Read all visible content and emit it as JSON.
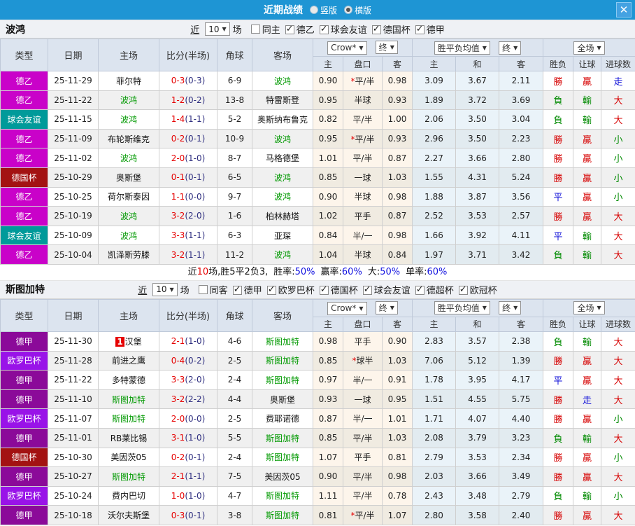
{
  "titlebar": {
    "title": "近期战绩",
    "vertical_label": "竖版",
    "horizontal_label": "横版",
    "selected": "horizontal"
  },
  "icons": {
    "close": "✕",
    "dropdown_arrow": "▼",
    "check": "✓"
  },
  "filter_words": {
    "near": "近",
    "games": "场"
  },
  "header": {
    "type": "类型",
    "date": "日期",
    "home": "主场",
    "score": "比分(半场)",
    "corner": "角球",
    "away": "客场",
    "odds_source": "Crow*",
    "final_label": "终",
    "avg_label": "胜平负均值",
    "final2_label": "终",
    "fulltime_label": "全场",
    "sub_home": "主",
    "sub_handicap": "盘口",
    "sub_away": "客",
    "sub_avg_home": "主",
    "sub_avg_draw": "和",
    "sub_avg_away": "客",
    "sub_result": "胜负",
    "sub_let": "让球",
    "sub_goals": "进球数"
  },
  "sections": [
    {
      "team": "波鸿",
      "count": "10",
      "same_label": "同主",
      "same_checked": false,
      "leagues": [
        {
          "label": "德乙",
          "checked": true
        },
        {
          "label": "球会友谊",
          "checked": true
        },
        {
          "label": "德国杯",
          "checked": true
        },
        {
          "label": "德甲",
          "checked": true
        }
      ],
      "rows": [
        {
          "type": "德乙",
          "tc": "#C902C9",
          "date": "25-11-29",
          "home": "菲尔特",
          "hs": false,
          "badge": "",
          "score": "0-3",
          "half": "(0-3)",
          "corner": "6-9",
          "away": "波鸿",
          "as": true,
          "o1": "0.90",
          "hc": "*平/半",
          "o2": "0.98",
          "a1": "3.09",
          "aX": "3.67",
          "a2": "2.11",
          "res": "勝",
          "resc": "r",
          "let": "贏",
          "letc": "r",
          "ou": "走",
          "ouc": "b"
        },
        {
          "type": "德乙",
          "tc": "#C902C9",
          "date": "25-11-22",
          "home": "波鸿",
          "hs": true,
          "badge": "",
          "score": "1-2",
          "half": "(0-2)",
          "corner": "13-8",
          "away": "特雷斯登",
          "as": false,
          "o1": "0.95",
          "hc": "半球",
          "o2": "0.93",
          "a1": "1.89",
          "aX": "3.72",
          "a2": "3.69",
          "res": "負",
          "resc": "g",
          "let": "輸",
          "letc": "g",
          "ou": "大",
          "ouc": "r"
        },
        {
          "type": "球会友谊",
          "tc": "#009A9A",
          "date": "25-11-15",
          "home": "波鸿",
          "hs": true,
          "badge": "",
          "score": "1-4",
          "half": "(1-1)",
          "corner": "5-2",
          "away": "奥斯纳布鲁克",
          "as": false,
          "o1": "0.82",
          "hc": "平/半",
          "o2": "1.00",
          "a1": "2.06",
          "aX": "3.50",
          "a2": "3.04",
          "res": "負",
          "resc": "g",
          "let": "輸",
          "letc": "g",
          "ou": "大",
          "ouc": "r"
        },
        {
          "type": "德乙",
          "tc": "#C902C9",
          "date": "25-11-09",
          "home": "布轮斯维克",
          "hs": false,
          "badge": "",
          "score": "0-2",
          "half": "(0-1)",
          "corner": "10-9",
          "away": "波鸿",
          "as": true,
          "o1": "0.95",
          "hc": "*平/半",
          "o2": "0.93",
          "a1": "2.96",
          "aX": "3.50",
          "a2": "2.23",
          "res": "勝",
          "resc": "r",
          "let": "贏",
          "letc": "r",
          "ou": "小",
          "ouc": "g"
        },
        {
          "type": "德乙",
          "tc": "#C902C9",
          "date": "25-11-02",
          "home": "波鸿",
          "hs": true,
          "badge": "",
          "score": "2-0",
          "half": "(1-0)",
          "corner": "8-7",
          "away": "马格德堡",
          "as": false,
          "o1": "1.01",
          "hc": "平/半",
          "o2": "0.87",
          "a1": "2.27",
          "aX": "3.66",
          "a2": "2.80",
          "res": "勝",
          "resc": "r",
          "let": "贏",
          "letc": "r",
          "ou": "小",
          "ouc": "g"
        },
        {
          "type": "德国杯",
          "tc": "#A31212",
          "date": "25-10-29",
          "home": "奥斯堡",
          "hs": false,
          "badge": "",
          "score": "0-1",
          "half": "(0-1)",
          "corner": "6-5",
          "away": "波鸿",
          "as": true,
          "o1": "0.85",
          "hc": "一球",
          "o2": "1.03",
          "a1": "1.55",
          "aX": "4.31",
          "a2": "5.24",
          "res": "勝",
          "resc": "r",
          "let": "贏",
          "letc": "r",
          "ou": "小",
          "ouc": "g"
        },
        {
          "type": "德乙",
          "tc": "#C902C9",
          "date": "25-10-25",
          "home": "荷尔斯泰因",
          "hs": false,
          "badge": "",
          "score": "1-1",
          "half": "(0-0)",
          "corner": "9-7",
          "away": "波鸿",
          "as": true,
          "o1": "0.90",
          "hc": "半球",
          "o2": "0.98",
          "a1": "1.88",
          "aX": "3.87",
          "a2": "3.56",
          "res": "平",
          "resc": "b",
          "let": "贏",
          "letc": "r",
          "ou": "小",
          "ouc": "g"
        },
        {
          "type": "德乙",
          "tc": "#C902C9",
          "date": "25-10-19",
          "home": "波鸿",
          "hs": true,
          "badge": "",
          "score": "3-2",
          "half": "(2-0)",
          "corner": "1-6",
          "away": "柏林赫塔",
          "as": false,
          "o1": "1.02",
          "hc": "平手",
          "o2": "0.87",
          "a1": "2.52",
          "aX": "3.53",
          "a2": "2.57",
          "res": "勝",
          "resc": "r",
          "let": "贏",
          "letc": "r",
          "ou": "大",
          "ouc": "r"
        },
        {
          "type": "球会友谊",
          "tc": "#009A9A",
          "date": "25-10-09",
          "home": "波鸿",
          "hs": true,
          "badge": "",
          "score": "3-3",
          "half": "(1-1)",
          "corner": "6-3",
          "away": "亚琛",
          "as": false,
          "o1": "0.84",
          "hc": "半/一",
          "o2": "0.98",
          "a1": "1.66",
          "aX": "3.92",
          "a2": "4.11",
          "res": "平",
          "resc": "b",
          "let": "輸",
          "letc": "g",
          "ou": "大",
          "ouc": "r"
        },
        {
          "type": "德乙",
          "tc": "#C902C9",
          "date": "25-10-04",
          "home": "凯泽斯劳滕",
          "hs": false,
          "badge": "",
          "score": "3-2",
          "half": "(1-1)",
          "corner": "11-2",
          "away": "波鸿",
          "as": true,
          "o1": "1.04",
          "hc": "半球",
          "o2": "0.84",
          "a1": "1.97",
          "aX": "3.71",
          "a2": "3.42",
          "res": "負",
          "resc": "g",
          "let": "輸",
          "letc": "g",
          "ou": "大",
          "ouc": "r"
        }
      ],
      "summary": {
        "pre": "近",
        "count": "10",
        "mid": "场,胜5平2负3,",
        "stats": [
          {
            "label": "胜率:",
            "value": "50%"
          },
          {
            "label": "赢率:",
            "value": "60%"
          },
          {
            "label": "大:",
            "value": "50%"
          },
          {
            "label": "单率:",
            "value": "60%"
          }
        ]
      }
    },
    {
      "team": "斯图加特",
      "count": "10",
      "same_label": "同客",
      "same_checked": false,
      "leagues": [
        {
          "label": "德甲",
          "checked": true
        },
        {
          "label": "欧罗巴杯",
          "checked": true
        },
        {
          "label": "德国杯",
          "checked": true
        },
        {
          "label": "球会友谊",
          "checked": true
        },
        {
          "label": "德超杯",
          "checked": true
        },
        {
          "label": "欧冠杯",
          "checked": true
        }
      ],
      "rows": [
        {
          "type": "德甲",
          "tc": "#8B0A99",
          "date": "25-11-30",
          "home": "汉堡",
          "hs": false,
          "badge": "1",
          "score": "2-1",
          "half": "(1-0)",
          "corner": "4-6",
          "away": "斯图加特",
          "as": true,
          "o1": "0.98",
          "hc": "平手",
          "o2": "0.90",
          "a1": "2.83",
          "aX": "3.57",
          "a2": "2.38",
          "res": "負",
          "resc": "g",
          "let": "輸",
          "letc": "g",
          "ou": "大",
          "ouc": "r"
        },
        {
          "type": "欧罗巴杯",
          "tc": "#9913E8",
          "date": "25-11-28",
          "home": "前进之鹰",
          "hs": false,
          "badge": "",
          "score": "0-4",
          "half": "(0-2)",
          "corner": "2-5",
          "away": "斯图加特",
          "as": true,
          "o1": "0.85",
          "hc": "*球半",
          "o2": "1.03",
          "a1": "7.06",
          "aX": "5.12",
          "a2": "1.39",
          "res": "勝",
          "resc": "r",
          "let": "贏",
          "letc": "r",
          "ou": "大",
          "ouc": "r"
        },
        {
          "type": "德甲",
          "tc": "#8B0A99",
          "date": "25-11-22",
          "home": "多特蒙德",
          "hs": false,
          "badge": "",
          "score": "3-3",
          "half": "(2-0)",
          "corner": "2-4",
          "away": "斯图加特",
          "as": true,
          "o1": "0.97",
          "hc": "半/一",
          "o2": "0.91",
          "a1": "1.78",
          "aX": "3.95",
          "a2": "4.17",
          "res": "平",
          "resc": "b",
          "let": "贏",
          "letc": "r",
          "ou": "大",
          "ouc": "r"
        },
        {
          "type": "德甲",
          "tc": "#8B0A99",
          "date": "25-11-10",
          "home": "斯图加特",
          "hs": true,
          "badge": "",
          "score": "3-2",
          "half": "(2-2)",
          "corner": "4-4",
          "away": "奥斯堡",
          "as": false,
          "o1": "0.93",
          "hc": "一球",
          "o2": "0.95",
          "a1": "1.51",
          "aX": "4.55",
          "a2": "5.75",
          "res": "勝",
          "resc": "r",
          "let": "走",
          "letc": "b",
          "ou": "大",
          "ouc": "r"
        },
        {
          "type": "欧罗巴杯",
          "tc": "#9913E8",
          "date": "25-11-07",
          "home": "斯图加特",
          "hs": true,
          "badge": "",
          "score": "2-0",
          "half": "(0-0)",
          "corner": "2-5",
          "away": "费耶诺德",
          "as": false,
          "o1": "0.87",
          "hc": "半/一",
          "o2": "1.01",
          "a1": "1.71",
          "aX": "4.07",
          "a2": "4.40",
          "res": "勝",
          "resc": "r",
          "let": "贏",
          "letc": "r",
          "ou": "小",
          "ouc": "g"
        },
        {
          "type": "德甲",
          "tc": "#8B0A99",
          "date": "25-11-01",
          "home": "RB莱比锡",
          "hs": false,
          "badge": "",
          "score": "3-1",
          "half": "(1-0)",
          "corner": "5-5",
          "away": "斯图加特",
          "as": true,
          "o1": "0.85",
          "hc": "平/半",
          "o2": "1.03",
          "a1": "2.08",
          "aX": "3.79",
          "a2": "3.23",
          "res": "負",
          "resc": "g",
          "let": "輸",
          "letc": "g",
          "ou": "大",
          "ouc": "r"
        },
        {
          "type": "德国杯",
          "tc": "#A31212",
          "date": "25-10-30",
          "home": "美因茨05",
          "hs": false,
          "badge": "",
          "score": "0-2",
          "half": "(0-1)",
          "corner": "2-4",
          "away": "斯图加特",
          "as": true,
          "o1": "1.07",
          "hc": "平手",
          "o2": "0.81",
          "a1": "2.79",
          "aX": "3.53",
          "a2": "2.34",
          "res": "勝",
          "resc": "r",
          "let": "贏",
          "letc": "r",
          "ou": "小",
          "ouc": "g"
        },
        {
          "type": "德甲",
          "tc": "#8B0A99",
          "date": "25-10-27",
          "home": "斯图加特",
          "hs": true,
          "badge": "",
          "score": "2-1",
          "half": "(1-1)",
          "corner": "7-5",
          "away": "美因茨05",
          "as": false,
          "o1": "0.90",
          "hc": "平/半",
          "o2": "0.98",
          "a1": "2.03",
          "aX": "3.66",
          "a2": "3.49",
          "res": "勝",
          "resc": "r",
          "let": "贏",
          "letc": "r",
          "ou": "大",
          "ouc": "r"
        },
        {
          "type": "欧罗巴杯",
          "tc": "#9913E8",
          "date": "25-10-24",
          "home": "费内巴切",
          "hs": false,
          "badge": "",
          "score": "1-0",
          "half": "(1-0)",
          "corner": "4-7",
          "away": "斯图加特",
          "as": true,
          "o1": "1.11",
          "hc": "平/半",
          "o2": "0.78",
          "a1": "2.43",
          "aX": "3.48",
          "a2": "2.79",
          "res": "負",
          "resc": "g",
          "let": "輸",
          "letc": "g",
          "ou": "小",
          "ouc": "g"
        },
        {
          "type": "德甲",
          "tc": "#8B0A99",
          "date": "25-10-18",
          "home": "沃尔夫斯堡",
          "hs": false,
          "badge": "",
          "score": "0-3",
          "half": "(0-1)",
          "corner": "3-8",
          "away": "斯图加特",
          "as": true,
          "o1": "0.81",
          "hc": "*平/半",
          "o2": "1.07",
          "a1": "2.80",
          "aX": "3.58",
          "a2": "2.40",
          "res": "勝",
          "resc": "r",
          "let": "贏",
          "letc": "r",
          "ou": "大",
          "ouc": "r"
        }
      ]
    }
  ]
}
